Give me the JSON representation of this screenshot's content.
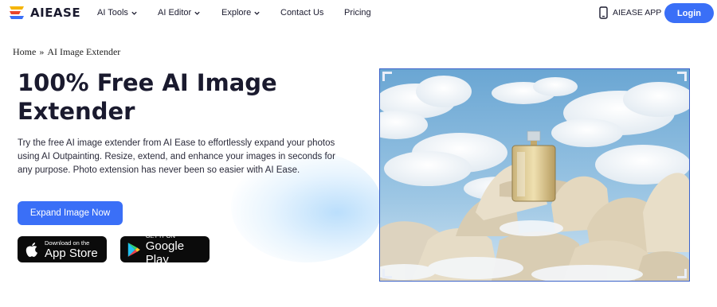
{
  "brand": {
    "name": "AIEASE",
    "accent": "#3a6ff7",
    "logo_colors": [
      "#f5b400",
      "#e8452c",
      "#3a6ff7"
    ]
  },
  "nav": {
    "items": [
      {
        "label": "AI Tools",
        "has_dropdown": true
      },
      {
        "label": "AI Editor",
        "has_dropdown": true
      },
      {
        "label": "Explore",
        "has_dropdown": true
      },
      {
        "label": "Contact Us",
        "has_dropdown": false
      },
      {
        "label": "Pricing",
        "has_dropdown": false
      }
    ],
    "app_label": "AIEASE APP",
    "app_icon": "phone-icon",
    "login_label": "Login"
  },
  "breadcrumb": {
    "home": "Home",
    "separator": "»",
    "current": "AI Image Extender"
  },
  "hero": {
    "title": "100% Free AI Image Extender",
    "description": "Try the free AI image extender from AI Ease to effortlessly expand your photos using AI Outpainting. Resize, extend, and enhance your images in seconds for any purpose. Photo extension has never been so easier with AI Ease.",
    "cta_label": "Expand Image Now"
  },
  "stores": {
    "appstore": {
      "small": "Download on the",
      "big": "App Store",
      "icon": "apple-icon"
    },
    "googleplay": {
      "small": "GET IT ON",
      "big": "Google Play",
      "icon": "google-play-icon"
    }
  },
  "preview": {
    "subject": "perfume bottle on rocks among clouds",
    "frame_color": "#3b62c9"
  }
}
